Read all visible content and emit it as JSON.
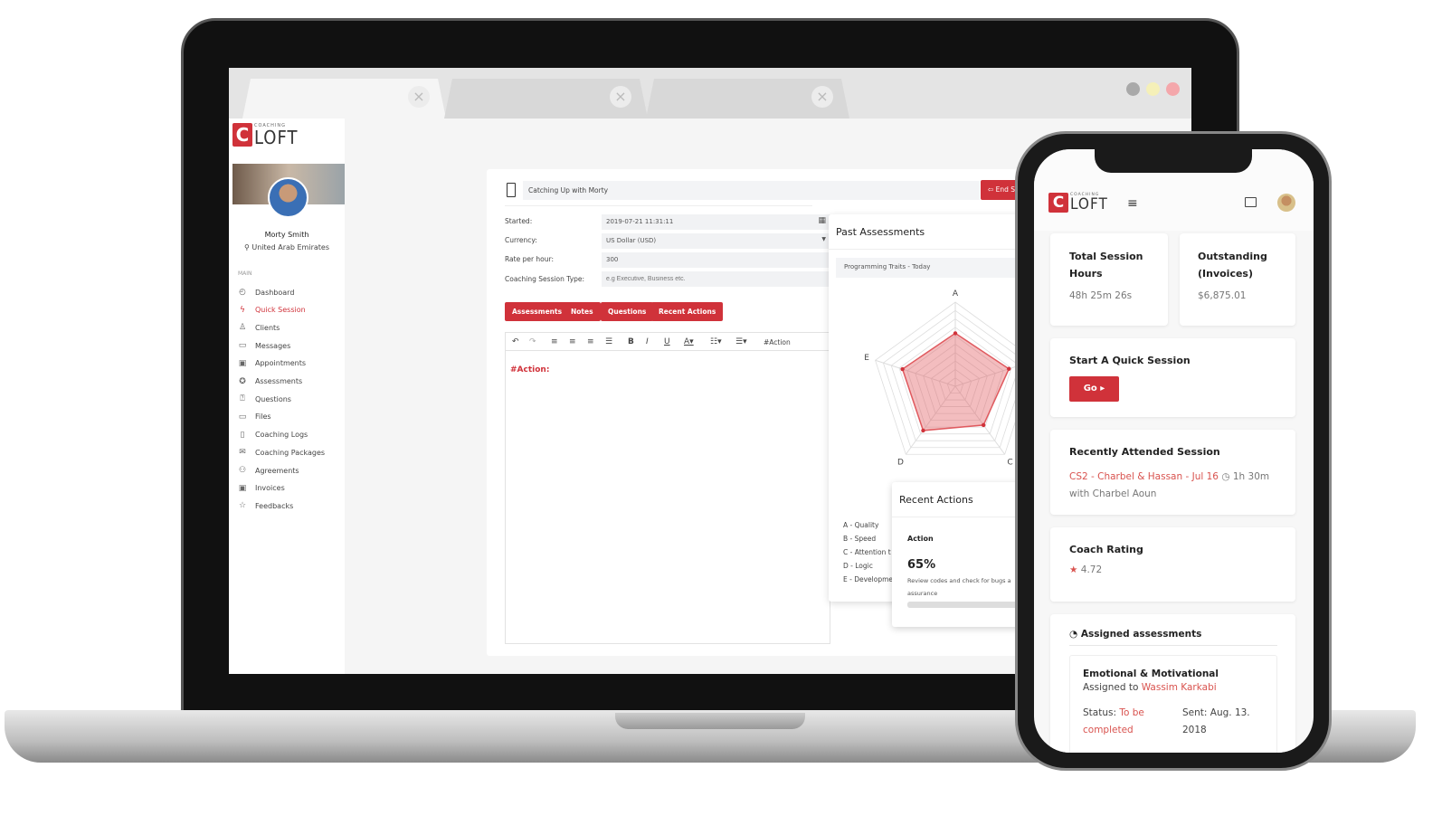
{
  "brand": {
    "logo_letter": "C",
    "logo_small": "COACHING",
    "logo_big": "LOFT",
    "accent": "#d0323a"
  },
  "browser": {
    "tabs": [
      {
        "close": "×"
      },
      {
        "close": "×"
      },
      {
        "close": "×"
      }
    ],
    "window_dots": [
      "#a9a9a9",
      "#f5f0b8",
      "#f4a7ab"
    ]
  },
  "profile": {
    "name": "Morty Smith",
    "location": "United Arab Emirates"
  },
  "sidebar": {
    "section": "MAIN",
    "items": [
      {
        "label": "Dashboard",
        "icon": "dashboard-icon"
      },
      {
        "label": "Quick Session",
        "icon": "lightning-icon",
        "active": true
      },
      {
        "label": "Clients",
        "icon": "users-icon"
      },
      {
        "label": "Messages",
        "icon": "message-icon"
      },
      {
        "label": "Appointments",
        "icon": "calendar-icon"
      },
      {
        "label": "Assessments",
        "icon": "assessment-icon"
      },
      {
        "label": "Questions",
        "icon": "question-icon"
      },
      {
        "label": "Files",
        "icon": "folder-icon"
      },
      {
        "label": "Coaching Logs",
        "icon": "notebook-icon"
      },
      {
        "label": "Coaching Packages",
        "icon": "package-icon"
      },
      {
        "label": "Agreements",
        "icon": "handshake-icon"
      },
      {
        "label": "Invoices",
        "icon": "invoice-icon"
      },
      {
        "label": "Feedbacks",
        "icon": "star-icon"
      }
    ]
  },
  "session": {
    "title": "Catching Up with Morty",
    "end_button": "End S",
    "fields": {
      "started_label": "Started:",
      "started_value": "2019-07-21 11:31:11",
      "currency_label": "Currency:",
      "currency_value": "US Dollar (USD)",
      "rate_label": "Rate per hour:",
      "rate_value": "300",
      "type_label": "Coaching Session Type:",
      "type_placeholder": "e.g Executive, Business etc."
    },
    "buttons": [
      "Assessments",
      "Notes",
      "Questions",
      "Recent Actions"
    ],
    "editor": {
      "tag_button": "#Action",
      "content": "#Action:"
    }
  },
  "past_assessments": {
    "title": "Past Assessments",
    "selected": "Programming Traits - Today",
    "legend": [
      "A - Quality",
      "B - Speed",
      "C - Attention t",
      "D - Logic",
      "E - Developme"
    ]
  },
  "chart_data": {
    "type": "radar",
    "axes": [
      "A",
      "B",
      "C",
      "D",
      "E"
    ],
    "values": [
      63,
      67,
      57,
      65,
      66
    ],
    "range": [
      0,
      100
    ],
    "grid": true,
    "color": "#e05a5f"
  },
  "recent_actions": {
    "title": "Recent Actions",
    "column": "Action",
    "percent": "65%",
    "progress": 65,
    "description": "Review codes and check for bugs a",
    "description2": "assurance"
  },
  "phone": {
    "total_hours": {
      "title1": "Total Session",
      "title2": "Hours",
      "value": "48h 25m 26s"
    },
    "outstanding": {
      "title1": "Outstanding",
      "title2": "(Invoices)",
      "value": "$6,875.01"
    },
    "quick": {
      "title": "Start A Quick Session",
      "button": "Go ▸"
    },
    "recent": {
      "title": "Recently Attended Session",
      "link": "CS2 - Charbel & Hassan - Jul 16",
      "duration": "1h 30m",
      "with": "with Charbel Aoun"
    },
    "rating": {
      "title": "Coach Rating",
      "value": "4.72"
    },
    "assigned": {
      "title": "Assigned assessments",
      "item_title": "Emotional & Motivational",
      "assigned_prefix": "Assigned to",
      "assignee": "Wassim Karkabi",
      "status_prefix": "Status:",
      "status1": "To be",
      "status2": "completed",
      "sent1": "Sent: Aug. 13.",
      "sent2": "2018"
    }
  }
}
